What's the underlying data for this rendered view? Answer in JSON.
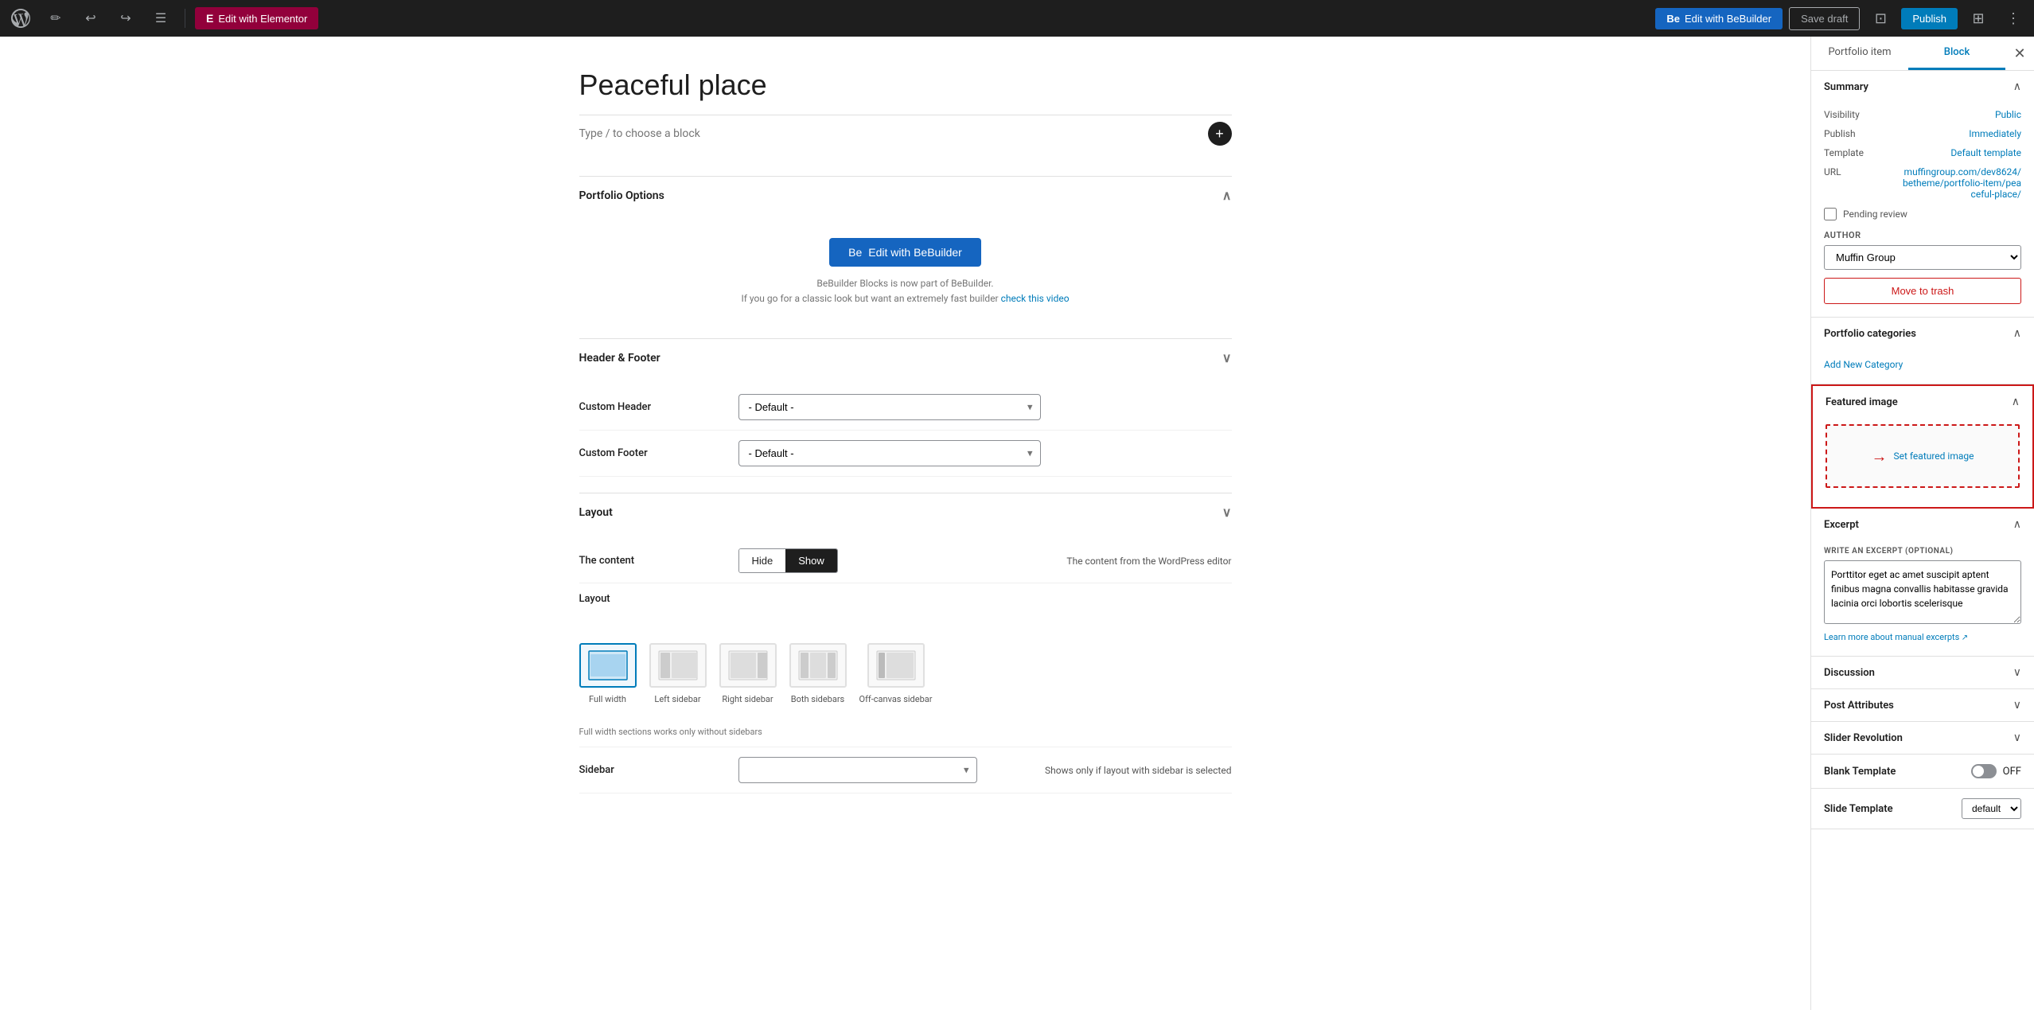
{
  "topbar": {
    "elementor_btn": "Edit with Elementor",
    "elementor_icon": "E",
    "bebuilder_btn_top": "Edit with BeBuilder",
    "bebuilder_icon": "Be",
    "save_draft_label": "Save draft",
    "publish_label": "Publish"
  },
  "editor": {
    "post_title": "Peaceful place",
    "block_placeholder": "Type / to choose a block"
  },
  "portfolio_options": {
    "section_label": "Portfolio Options",
    "bebuilder_main_btn": "Edit with BeBuilder",
    "bebuilder_note_line1": "BeBuilder Blocks is now part of BeBuilder.",
    "bebuilder_note_line2": "If you go for a classic look but want an extremely fast builder",
    "bebuilder_note_link": "check this video"
  },
  "header_footer": {
    "section_label": "Header & Footer",
    "custom_header_label": "Custom Header",
    "custom_header_placeholder": "- Default -",
    "custom_footer_label": "Custom Footer",
    "custom_footer_placeholder": "- Default -"
  },
  "layout_section": {
    "section_label": "Layout",
    "content_label": "The content",
    "hide_btn": "Hide",
    "show_btn": "Show",
    "content_note": "The content from the WordPress editor",
    "layout_label": "Layout",
    "layouts": [
      {
        "id": "full-width",
        "label": "Full width",
        "selected": true
      },
      {
        "id": "left-sidebar",
        "label": "Left sidebar",
        "selected": false
      },
      {
        "id": "right-sidebar",
        "label": "Right sidebar",
        "selected": false
      },
      {
        "id": "both-sidebars",
        "label": "Both sidebars",
        "selected": false
      },
      {
        "id": "off-canvas",
        "label": "Off-canvas sidebar",
        "selected": false
      }
    ],
    "layout_note": "Full width sections works only without sidebars",
    "sidebar_label": "Sidebar",
    "sidebar_note": "Shows only if layout with sidebar is selected"
  },
  "right_panel": {
    "tab_portfolio": "Portfolio item",
    "tab_block": "Block",
    "summary": {
      "title": "Summary",
      "visibility_label": "Visibility",
      "visibility_value": "Public",
      "publish_label": "Publish",
      "publish_value": "Immediately",
      "template_label": "Template",
      "template_value": "Default template",
      "url_label": "URL",
      "url_value": "muffingroup.com/dev8624/betheme/portfolio-item/peaceful-place/",
      "pending_review_label": "Pending review",
      "author_label": "AUTHOR",
      "author_value": "Muffin Group",
      "move_trash_label": "Move to trash"
    },
    "portfolio_categories": {
      "title": "Portfolio categories",
      "add_new_label": "Add New Category"
    },
    "featured_image": {
      "title": "Featured image",
      "set_label": "Set featured image"
    },
    "excerpt": {
      "title": "Excerpt",
      "write_label": "WRITE AN EXCERPT (OPTIONAL)",
      "excerpt_text": "Porttitor eget ac amet suscipit aptent finibus magna convallis habitasse gravida lacinia orci lobortis scelerisque",
      "learn_more_label": "Learn more about manual excerpts"
    },
    "discussion": {
      "title": "Discussion"
    },
    "post_attributes": {
      "title": "Post Attributes"
    },
    "slider_revolution": {
      "title": "Slider Revolution"
    },
    "blank_template": {
      "title": "Blank Template",
      "value": "OFF"
    },
    "slide_template": {
      "title": "Slide Template",
      "value": "default"
    }
  }
}
